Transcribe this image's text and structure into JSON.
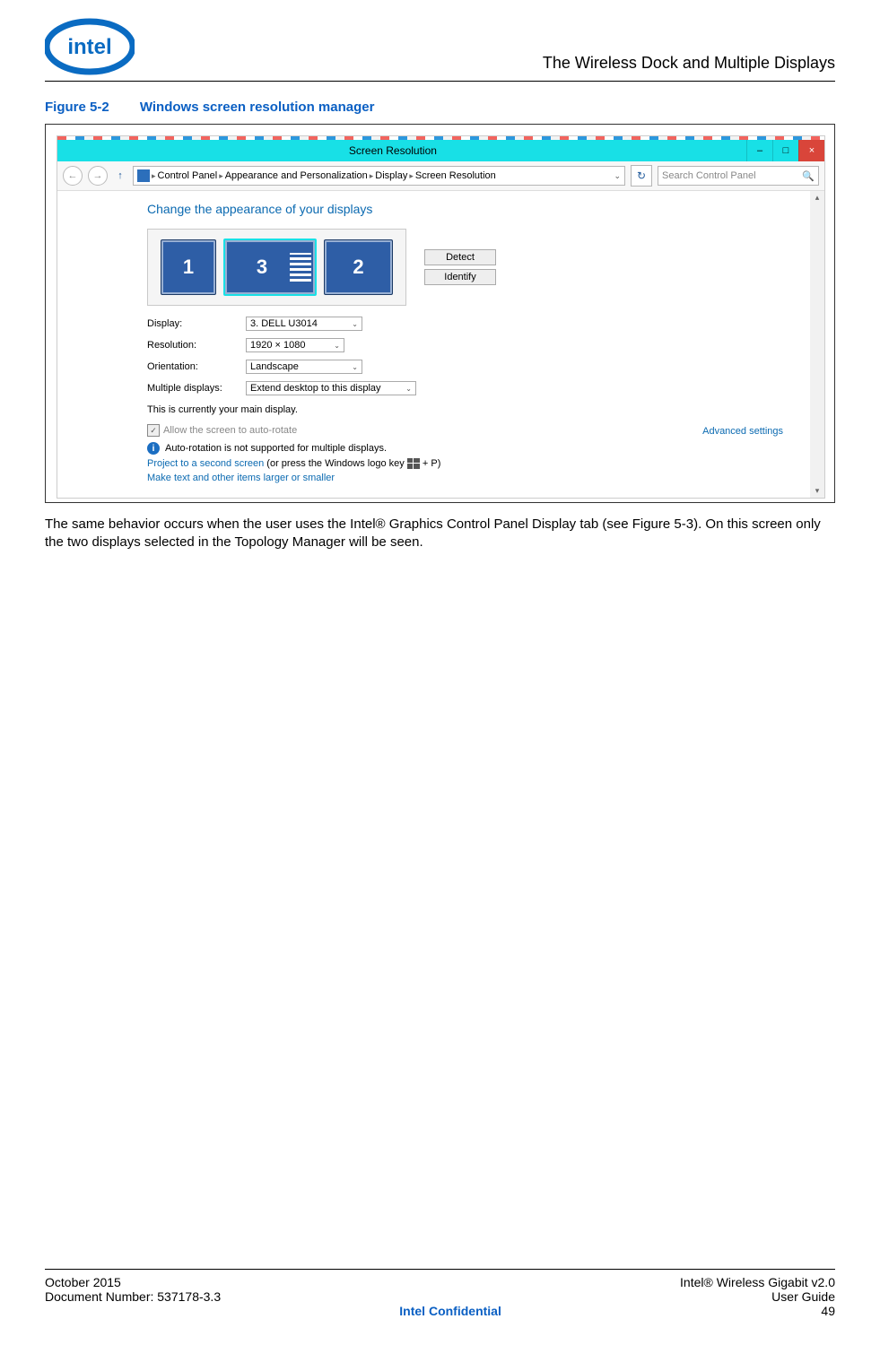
{
  "header": {
    "title": "The Wireless Dock and Multiple Displays"
  },
  "figure": {
    "label": "Figure 5-2",
    "title": "Windows screen resolution manager"
  },
  "screenshot": {
    "window_title": "Screen Resolution",
    "minimize_glyph": "–",
    "restore_glyph": "□",
    "close_glyph": "×",
    "up_glyph": "↑",
    "back_glyph": "←",
    "forward_glyph": "→",
    "breadcrumb": [
      "Control Panel",
      "Appearance and Personalization",
      "Display",
      "Screen Resolution"
    ],
    "refresh_glyph": "↻",
    "search_placeholder": "Search Control Panel",
    "search_icon": "🔍",
    "panel_title": "Change the appearance of your displays",
    "monitor_labels": {
      "m1": "1",
      "m3": "3",
      "m2": "2"
    },
    "buttons": {
      "detect": "Detect",
      "identify": "Identify"
    },
    "fields": {
      "display": {
        "label": "Display:",
        "value": "3. DELL U3014"
      },
      "resolution": {
        "label": "Resolution:",
        "value": "1920 × 1080"
      },
      "orientation": {
        "label": "Orientation:",
        "value": "Landscape"
      },
      "multiple": {
        "label": "Multiple displays:",
        "value": "Extend desktop to this display"
      }
    },
    "main_display_text": "This is currently your main display.",
    "auto_rotate_label": "Allow the screen to auto-rotate",
    "auto_rotate_info": "Auto-rotation is not supported for multiple displays.",
    "advanced_link": "Advanced settings",
    "project_link": "Project to a second screen",
    "project_suffix_a": " (or press the Windows logo key ",
    "project_suffix_b": " + P)",
    "make_text_link": "Make text and other items larger or smaller"
  },
  "body_text": "The same behavior occurs when the user uses the Intel® Graphics Control Panel Display tab (see Figure 5-3). On this screen only the two displays selected in the Topology Manager will be seen.",
  "footer": {
    "left1": "October 2015",
    "left2": "Document Number: 537178-3.3",
    "center": "Intel Confidential",
    "right1": "Intel® Wireless Gigabit v2.0",
    "right2": "User Guide",
    "right3": "49"
  }
}
